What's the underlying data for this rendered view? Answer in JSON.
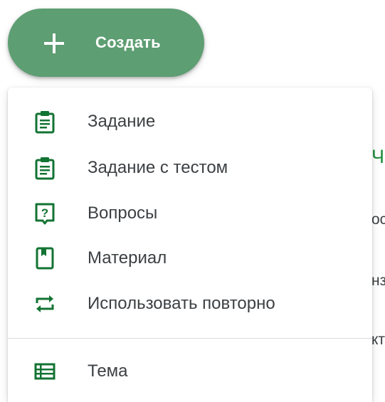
{
  "create_button": {
    "label": "Создать",
    "icon": "plus-icon"
  },
  "menu": {
    "items": [
      {
        "label": "Задание",
        "icon": "assignment-icon"
      },
      {
        "label": "Задание с тестом",
        "icon": "quiz-assignment-icon"
      },
      {
        "label": "Вопросы",
        "icon": "question-icon"
      },
      {
        "label": "Материал",
        "icon": "material-icon"
      },
      {
        "label": "Использовать повторно",
        "icon": "reuse-icon"
      }
    ],
    "topic": {
      "label": "Тема",
      "icon": "topic-icon"
    }
  },
  "background_fragments": [
    "Ча",
    "ос",
    "нз",
    "кт"
  ],
  "colors": {
    "accent": "#5d9e72",
    "icon_green": "#137333",
    "text": "#3c4043"
  }
}
